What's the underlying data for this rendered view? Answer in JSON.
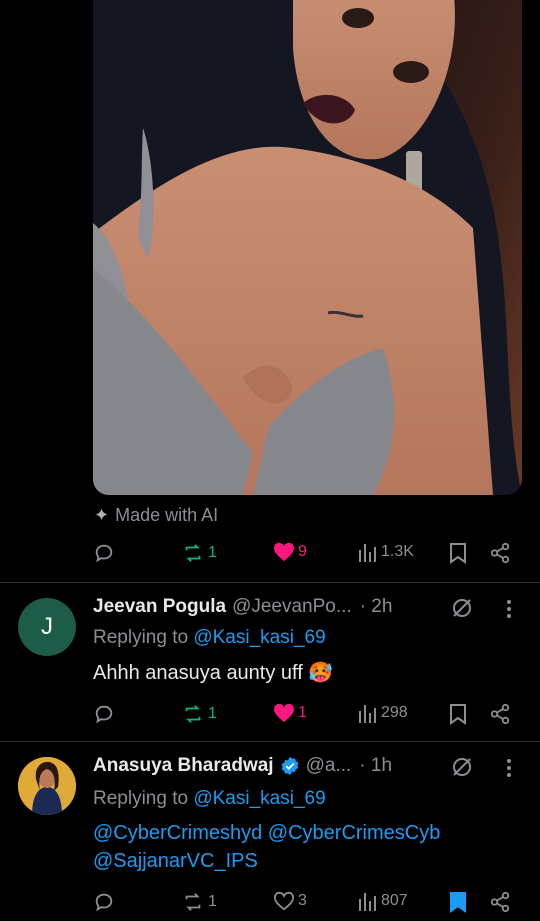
{
  "post": {
    "ai_label": "Made with AI",
    "actions": {
      "reposts": "1",
      "likes": "9",
      "views": "1.3K"
    }
  },
  "replies": [
    {
      "avatar_letter": "J",
      "name": "Jeevan Pogula",
      "handle": "@JeevanPo...",
      "time": "· 2h",
      "replying_prefix": "Replying to",
      "replying_to": "@Kasi_kasi_69",
      "text": "Ahhh anasuya aunty uff",
      "emoji": "🥵",
      "actions": {
        "reposts": "1",
        "likes": "1",
        "views": "298"
      }
    },
    {
      "name": "Anasuya Bharadwaj",
      "handle": "@a...",
      "time": "· 1h",
      "replying_prefix": "Replying to",
      "replying_to": "@Kasi_kasi_69",
      "mentions_line1": "@CyberCrimeshyd @CyberCrimesCyb",
      "mentions_line2": "@SajjanarVC_IPS",
      "actions": {
        "reposts": "1",
        "likes": "3",
        "views": "807"
      }
    }
  ],
  "colors": {
    "accent": "#1d9bf0",
    "like": "#f91880",
    "repost": "#00ba7c",
    "muted": "#8b8f94"
  }
}
